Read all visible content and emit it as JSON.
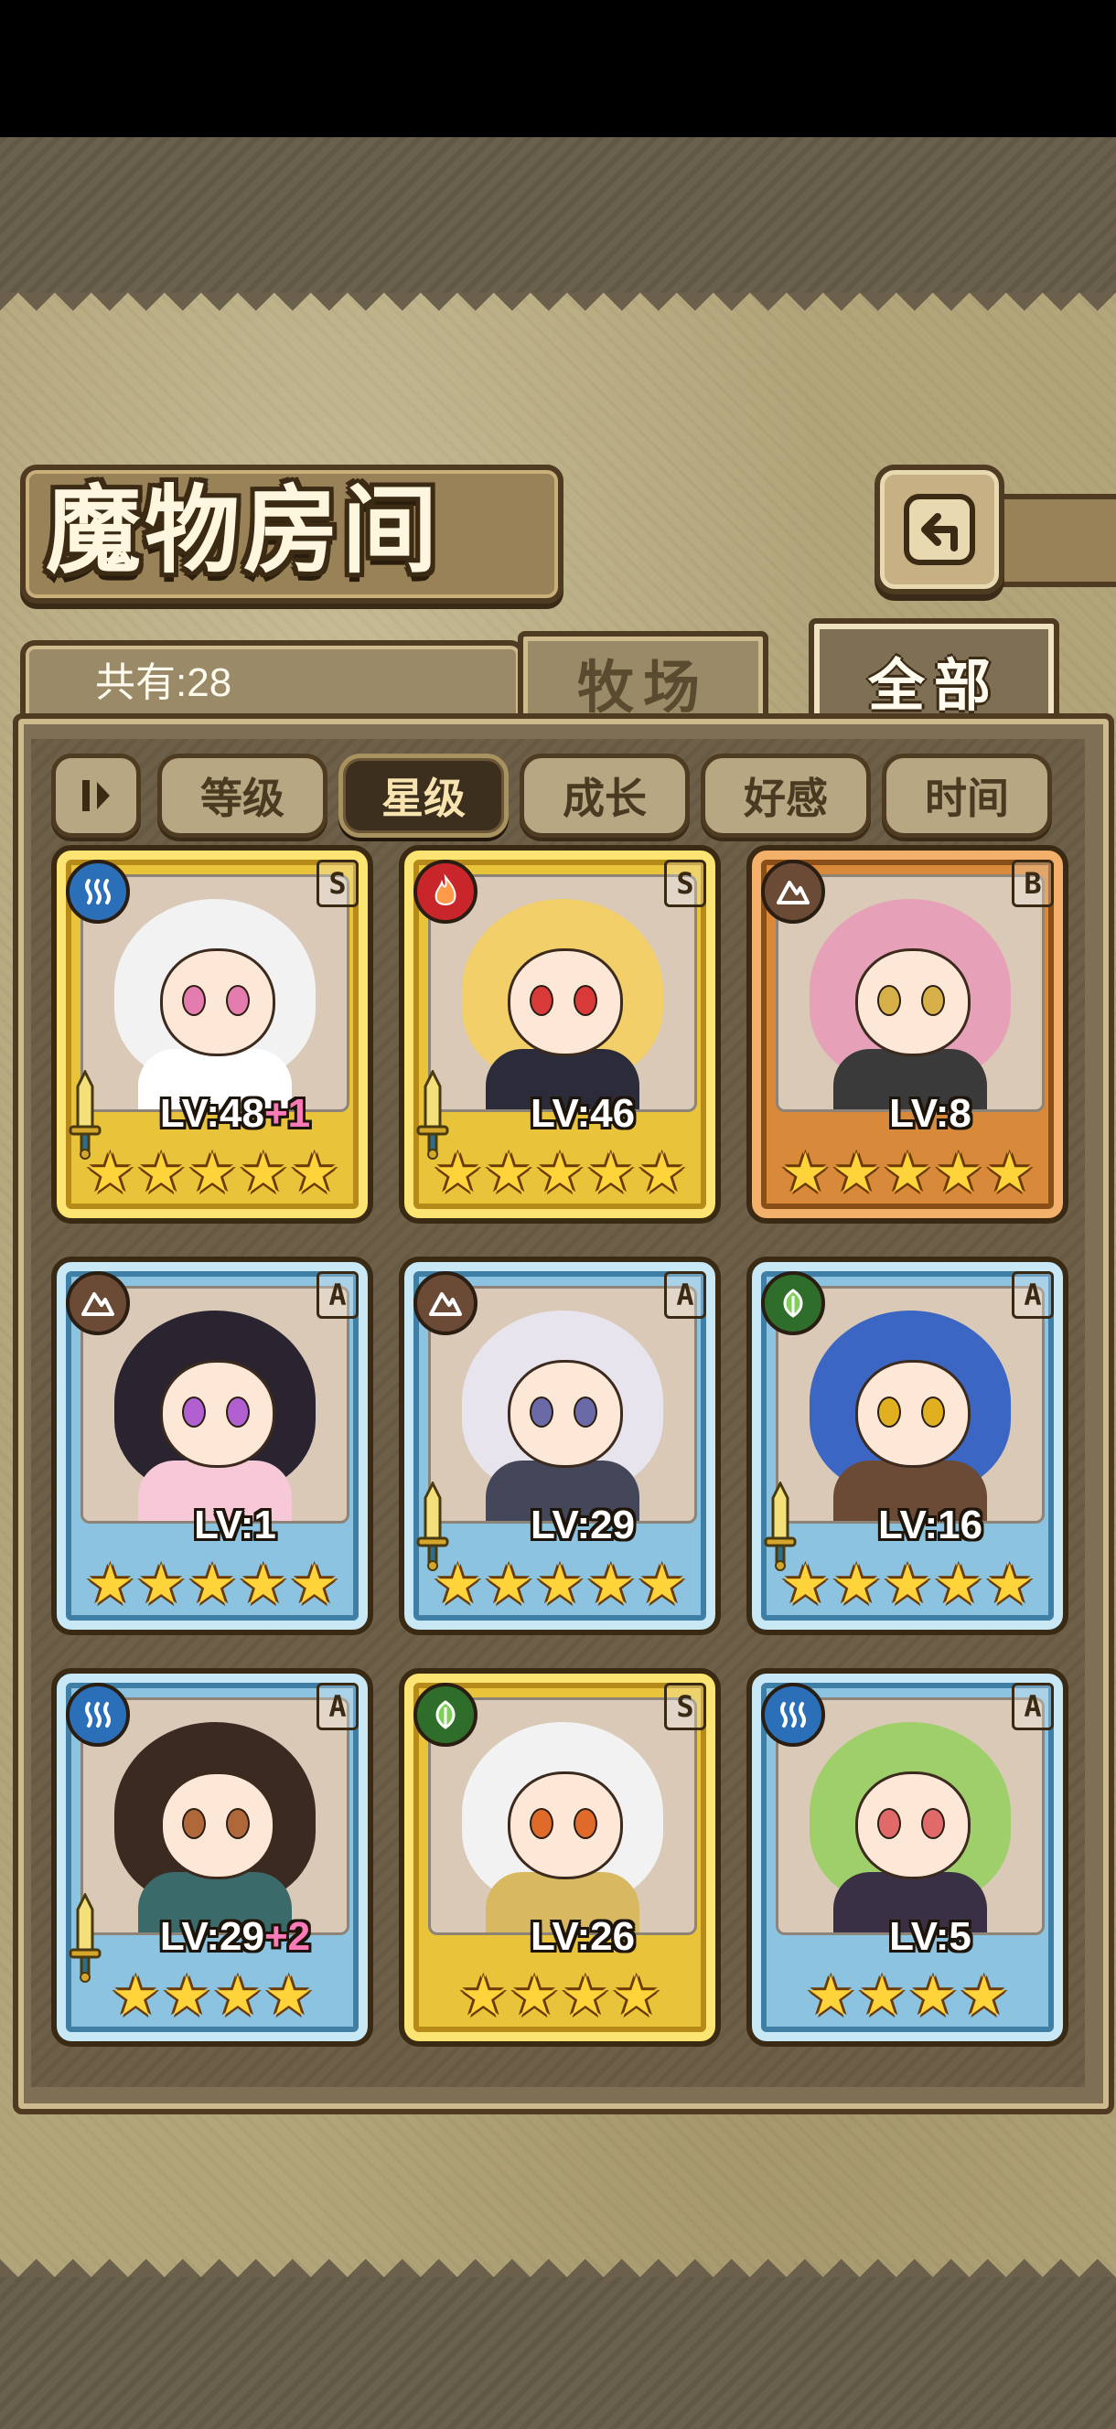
{
  "screen": {
    "title": "魔物房间",
    "back_button_icon": "return-arrow-icon",
    "count_label": "共有:28",
    "tabs": [
      {
        "label": "牧场",
        "active": false
      },
      {
        "label": "全部",
        "active": true
      }
    ],
    "sort_toggle_icon": "sort-order-icon",
    "filters": [
      {
        "label": "等级",
        "active": false
      },
      {
        "label": "星级",
        "active": true
      },
      {
        "label": "成长",
        "active": false
      },
      {
        "label": "好感",
        "active": false
      },
      {
        "label": "时间",
        "active": false
      }
    ]
  },
  "colors": {
    "gold_frame": "#e9c43b",
    "bronze_frame": "#d9893a",
    "blue_frame": "#8cc3e0",
    "water": "#2a6fb8",
    "fire": "#c8262b",
    "earth": "#6b4a36",
    "wood": "#2f6e2a"
  },
  "monsters": [
    {
      "element": "water",
      "element_icon": "water-waves-icon",
      "grade": "S",
      "rarity": "gold",
      "level": "LV:48",
      "bonus": "+1",
      "stars": 5,
      "has_sword": true,
      "hair": "#f2f2f2",
      "eyes": "#e47cb0",
      "outfit": "#ffffff"
    },
    {
      "element": "fire",
      "element_icon": "flame-icon",
      "grade": "S",
      "rarity": "gold",
      "level": "LV:46",
      "bonus": "",
      "stars": 5,
      "has_sword": true,
      "hair": "#f3cf69",
      "eyes": "#d83a3a",
      "outfit": "#2b2b3a"
    },
    {
      "element": "earth",
      "element_icon": "mountain-icon",
      "grade": "B",
      "rarity": "bronze",
      "level": "LV:8",
      "bonus": "",
      "stars": 5,
      "has_sword": false,
      "hair": "#e6a0b8",
      "eyes": "#d8b04a",
      "outfit": "#3a3a3a"
    },
    {
      "element": "earth",
      "element_icon": "mountain-icon",
      "grade": "A",
      "rarity": "blue",
      "level": "LV:1",
      "bonus": "",
      "stars": 5,
      "has_sword": false,
      "hair": "#2a2430",
      "eyes": "#b060d0",
      "outfit": "#f6c8d8"
    },
    {
      "element": "earth",
      "element_icon": "mountain-icon",
      "grade": "A",
      "rarity": "blue",
      "level": "LV:29",
      "bonus": "",
      "stars": 5,
      "has_sword": true,
      "hair": "#e8e4ee",
      "eyes": "#6a6aa8",
      "outfit": "#44465a"
    },
    {
      "element": "wood",
      "element_icon": "leaf-icon",
      "grade": "A",
      "rarity": "blue",
      "level": "LV:16",
      "bonus": "",
      "stars": 5,
      "has_sword": true,
      "hair": "#3b66c4",
      "eyes": "#e0b020",
      "outfit": "#6b4a36"
    },
    {
      "element": "water",
      "element_icon": "water-waves-icon",
      "grade": "A",
      "rarity": "blue",
      "level": "LV:29",
      "bonus": "+2",
      "stars": 4,
      "has_sword": true,
      "hair": "#3a2a22",
      "eyes": "#b0683a",
      "outfit": "#3a6a6a"
    },
    {
      "element": "wood",
      "element_icon": "leaf-icon",
      "grade": "S",
      "rarity": "gold",
      "level": "LV:26",
      "bonus": "",
      "stars": 4,
      "has_sword": false,
      "hair": "#f2f2f2",
      "eyes": "#e06a2a",
      "outfit": "#d8b860"
    },
    {
      "element": "water",
      "element_icon": "water-waves-icon",
      "grade": "A",
      "rarity": "blue",
      "level": "LV:5",
      "bonus": "",
      "stars": 4,
      "has_sword": false,
      "hair": "#9fcf6a",
      "eyes": "#e06a6a",
      "outfit": "#3a3046"
    }
  ]
}
